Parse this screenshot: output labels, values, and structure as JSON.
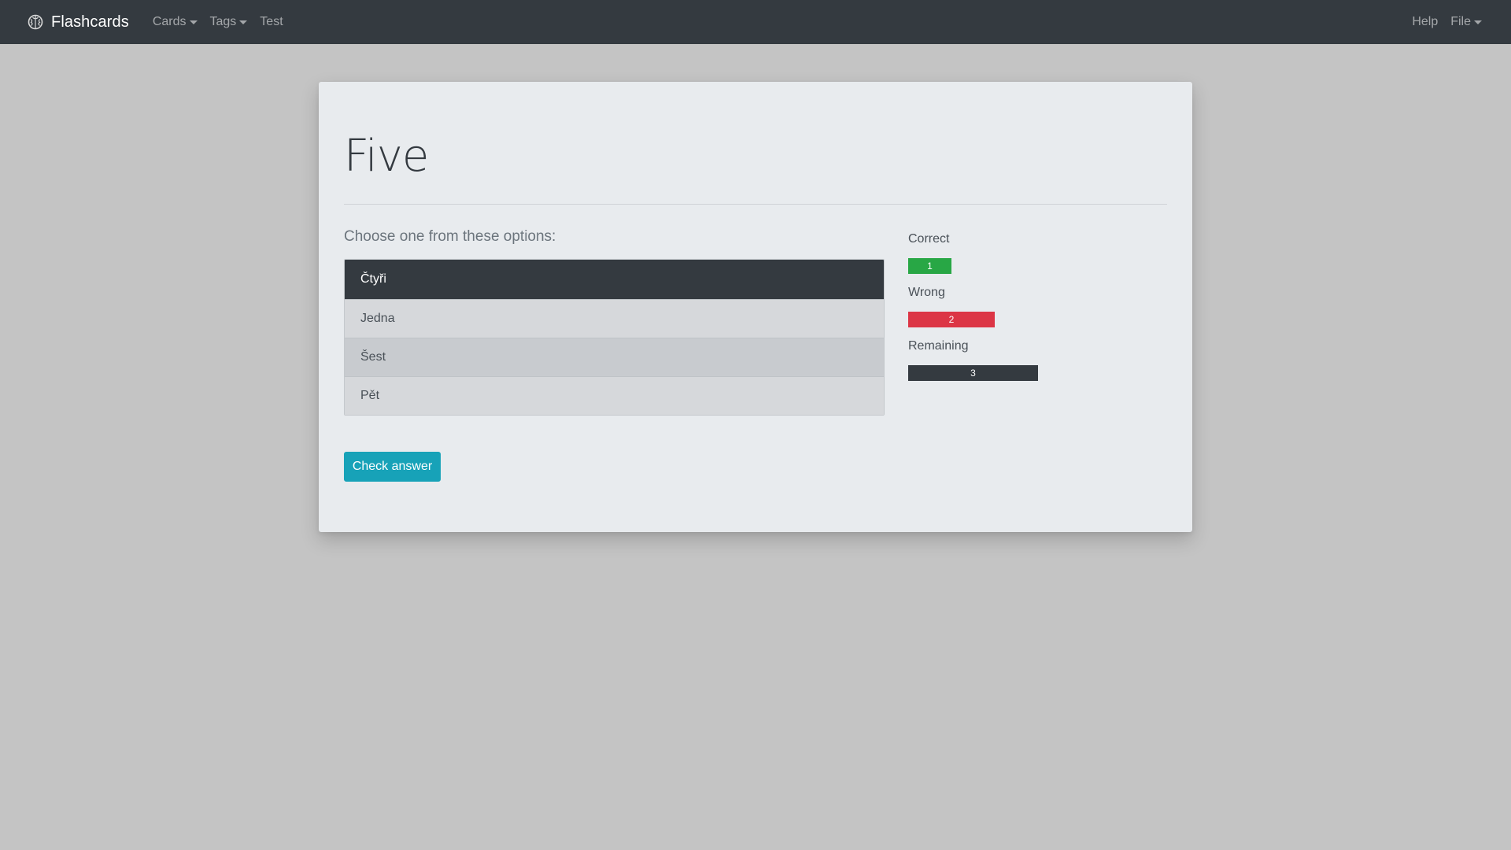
{
  "navbar": {
    "brand": {
      "icon": "brain-icon",
      "label": "Flashcards"
    },
    "left_items": [
      {
        "label": "Cards",
        "dropdown": true
      },
      {
        "label": "Tags",
        "dropdown": true
      },
      {
        "label": "Test",
        "dropdown": false
      }
    ],
    "right_items": [
      {
        "label": "Help",
        "dropdown": false
      },
      {
        "label": "File",
        "dropdown": true
      }
    ],
    "background": "#343a40"
  },
  "question": {
    "title": "Five",
    "prompt": "Choose one from these options:",
    "options": [
      {
        "label": "Čtyři",
        "selected": true
      },
      {
        "label": "Jedna",
        "selected": false
      },
      {
        "label": "Šest",
        "selected": false
      },
      {
        "label": "Pět",
        "selected": false
      }
    ],
    "check_button_label": "Check answer"
  },
  "stats": {
    "correct": {
      "label": "Correct",
      "value": "1",
      "color": "#28a745"
    },
    "wrong": {
      "label": "Wrong",
      "value": "2",
      "color": "#dc3545"
    },
    "remaining": {
      "label": "Remaining",
      "value": "3",
      "color": "#343a40"
    }
  },
  "colors": {
    "page_background": "#c4c4c4",
    "card_background": "#e8ebee",
    "accent": "#17a2b8"
  }
}
